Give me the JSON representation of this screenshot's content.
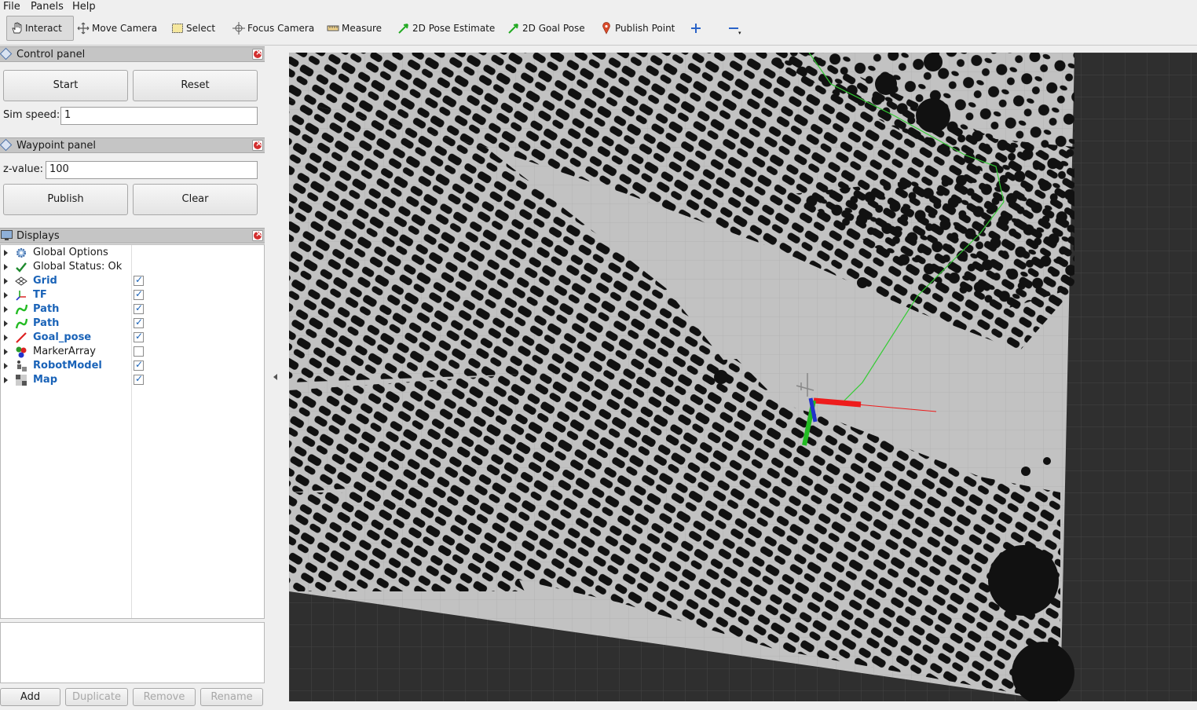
{
  "menu": {
    "file": "File",
    "panels": "Panels",
    "help": "Help"
  },
  "toolbar": {
    "interact": "Interact",
    "move_camera": "Move Camera",
    "select": "Select",
    "focus_camera": "Focus Camera",
    "measure": "Measure",
    "pose_estimate": "2D Pose Estimate",
    "goal_pose": "2D Goal Pose",
    "publish_point": "Publish Point"
  },
  "control_panel": {
    "title": "Control panel",
    "start": "Start",
    "reset": "Reset",
    "sim_speed_label": "Sim speed:",
    "sim_speed_value": "1"
  },
  "waypoint_panel": {
    "title": "Waypoint panel",
    "z_label": "z-value:",
    "z_value": "100",
    "publish": "Publish",
    "clear": "Clear"
  },
  "displays": {
    "title": "Displays",
    "items": [
      {
        "label": "Global Options",
        "checked": null,
        "bold": false,
        "icon": "gear-icon"
      },
      {
        "label": "Global Status: Ok",
        "checked": null,
        "bold": false,
        "icon": "check-icon"
      },
      {
        "label": "Grid",
        "checked": true,
        "bold": true,
        "icon": "grid-icon"
      },
      {
        "label": "TF",
        "checked": true,
        "bold": true,
        "icon": "tf-icon"
      },
      {
        "label": "Path",
        "checked": true,
        "bold": true,
        "icon": "path-icon"
      },
      {
        "label": "Path",
        "checked": true,
        "bold": true,
        "icon": "path-icon"
      },
      {
        "label": "Goal_pose",
        "checked": true,
        "bold": true,
        "icon": "pose-icon"
      },
      {
        "label": "MarkerArray",
        "checked": false,
        "bold": false,
        "icon": "marker-icon"
      },
      {
        "label": "RobotModel",
        "checked": true,
        "bold": true,
        "icon": "robot-icon"
      },
      {
        "label": "Map",
        "checked": true,
        "bold": true,
        "icon": "map-icon"
      }
    ],
    "add": "Add",
    "duplicate": "Duplicate",
    "remove": "Remove",
    "rename": "Rename"
  },
  "colors": {
    "path": "#33cc33",
    "tf_x": "#ee1c1c",
    "tf_y": "#22bb22",
    "tf_z": "#2233cc",
    "map_free": "#c0c0c0",
    "map_occupied": "#111111"
  }
}
